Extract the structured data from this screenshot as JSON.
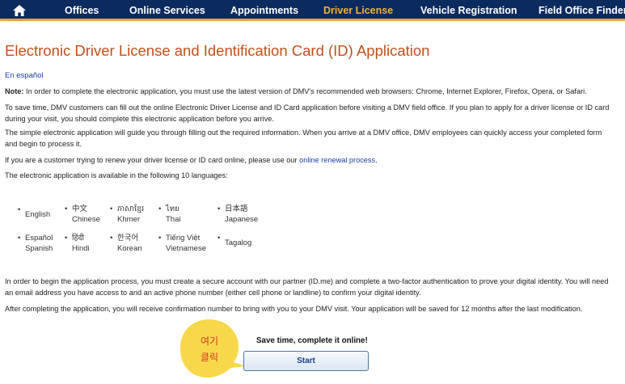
{
  "nav": {
    "home_icon": "home-icon",
    "items": [
      {
        "label": "Offices",
        "active": false
      },
      {
        "label": "Online Services",
        "active": false
      },
      {
        "label": "Appointments",
        "active": false
      },
      {
        "label": "Driver License",
        "active": true
      },
      {
        "label": "Vehicle Registration",
        "active": false
      },
      {
        "label": "Field Office Finder",
        "active": false
      }
    ],
    "active_color": "#f2b233",
    "bar_color": "#0b2a5e"
  },
  "main": {
    "title": "Electronic Driver License and Identification Card (ID) Application",
    "spanish_link": "En español",
    "note_label": "Note:",
    "note_text": " In order to complete the electronic application, you must use the latest version of DMV's recommended web browsers: Chrome, Internet Explorer, Firefox, Opera, or Safari.",
    "para_save_time": "To save time, DMV customers can fill out the online Electronic Driver License and ID Card application before visiting a DMV field office. If you plan to apply for a driver license or ID card during your visit, you should complete this electronic application before you arrive.",
    "para_simple": "The simple electronic application will guide you through filling out the required information. When you arrive at a DMV office, DMV employees can quickly access your completed form and begin to process it.",
    "renew_prefix": "If you are a customer trying to renew your driver license or ID card online, please use our ",
    "renew_link": "online renewal process",
    "renew_suffix": ".",
    "languages_intro": "The electronic application is available in the following 10 languages:",
    "para_begin": "In order to begin the application process, you must create a secure account with our partner (ID.me) and complete a two-factor authentication to prove your digital identity.  You will need an email address you have access to and an active phone number (either cell phone or landline) to confirm your digital identity.",
    "para_after": "After completing the application, you will receive confirmation number to bring with you to your DMV visit. Your application will be saved for 12 months after the last modification."
  },
  "languages": [
    {
      "native": "English",
      "english": ""
    },
    {
      "native": "中文",
      "english": "Chinese"
    },
    {
      "native": "ភាសាខ្មែរ",
      "english": "Khmer"
    },
    {
      "native": "ไทย",
      "english": "Thai"
    },
    {
      "native": "日本語",
      "english": "Japanese"
    },
    {
      "native": "Español",
      "english": "Spanish"
    },
    {
      "native": "हिंदी",
      "english": "Hindi"
    },
    {
      "native": "한국어",
      "english": "Korean"
    },
    {
      "native": "Tiếng Việt",
      "english": "Vietnamese"
    },
    {
      "native": "Tagalog",
      "english": ""
    }
  ],
  "cta": {
    "label": "Save time, complete it online!",
    "button": "Start",
    "callout_line1": "여기",
    "callout_line2": "클릭",
    "callout_color": "#f7d84a",
    "callout_text_color": "#d8362a"
  }
}
